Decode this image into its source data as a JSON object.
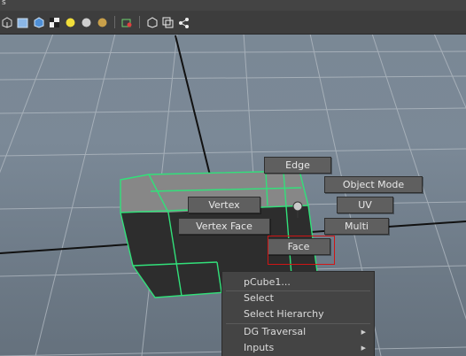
{
  "toolbar": {
    "title_fragment": "s",
    "icons": [
      "cube-wire-icon",
      "cube-smooth-icon",
      "cube-textured-icon",
      "checker-icon",
      "light-yellow-icon",
      "sphere-grey-icon",
      "sphere-gold-icon",
      "camera-icon",
      "select-icon",
      "isolate-icon",
      "xray-icon",
      "share-icon"
    ]
  },
  "marking_menu": {
    "edge": "Edge",
    "object_mode": "Object Mode",
    "vertex": "Vertex",
    "uv": "UV",
    "vertex_face": "Vertex Face",
    "multi": "Multi",
    "face": "Face"
  },
  "context_menu": {
    "object_name": "pCube1...",
    "select": "Select",
    "select_hierarchy": "Select Hierarchy",
    "dg_traversal": "DG Traversal",
    "inputs": "Inputs"
  },
  "colors": {
    "selection_wire": "#32e07a",
    "highlight": "#d01515",
    "menu_bg": "#5f5f5f"
  }
}
